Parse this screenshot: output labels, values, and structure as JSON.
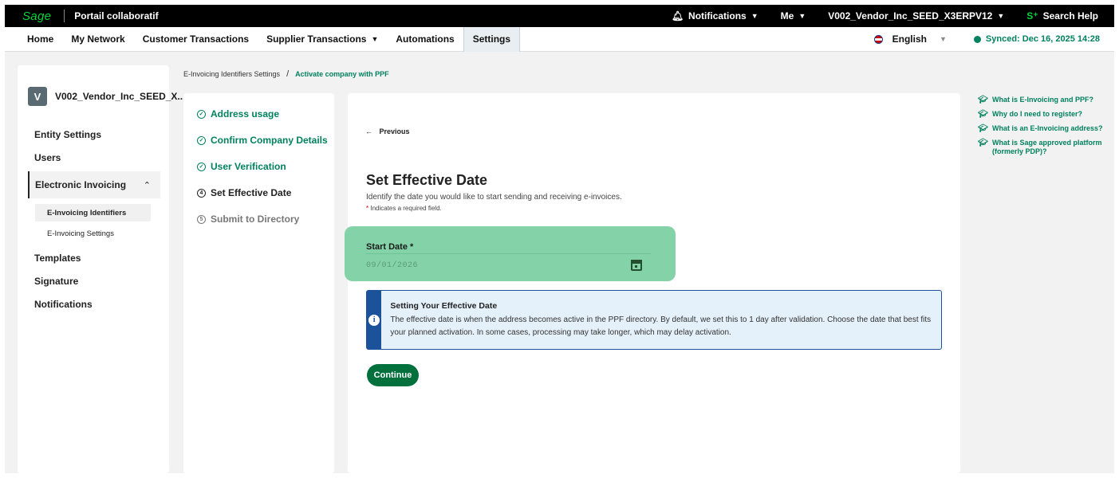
{
  "topbar": {
    "logo": "Sage",
    "app_title": "Portail collaboratif",
    "notifications": "Notifications",
    "me": "Me",
    "company": "V002_Vendor_Inc_SEED_X3ERPV12",
    "search_help": "Search Help"
  },
  "nav": {
    "items": [
      "Home",
      "My Network",
      "Customer Transactions",
      "Supplier Transactions",
      "Automations",
      "Settings"
    ],
    "language": "English",
    "synced": "Synced: Dec 16, 2025 14:28"
  },
  "sidebar": {
    "avatar": "V",
    "entity": "V002_Vendor_Inc_SEED_X...",
    "entity_settings": "Entity Settings",
    "users": "Users",
    "electronic_invoicing": "Electronic Invoicing",
    "sub_identifiers": "E-Invoicing Identifiers",
    "sub_settings": "E-Invoicing Settings",
    "templates": "Templates",
    "signature": "Signature",
    "notifications": "Notifications"
  },
  "breadcrumb": {
    "parent": "E-Invoicing Identifiers Settings",
    "separator": "/",
    "current": "Activate company with PPF"
  },
  "steps": {
    "s1": "Address usage",
    "s2": "Confirm Company Details",
    "s3": "User Verification",
    "s4_num": "4",
    "s4": "Set Effective Date",
    "s5_num": "5",
    "s5": "Submit to Directory"
  },
  "main": {
    "previous": "Previous",
    "title": "Set Effective Date",
    "description": "Identify the date you would like to start sending and receiving e-invoices.",
    "required_mark": "*",
    "required_note": " Indicates a required field.",
    "start_date_label": "Start Date *",
    "start_date_value": "09/01/2026",
    "info_title": "Setting Your Effective Date",
    "info_text": "The effective date is when the address becomes active in the PPF directory. By default, we set this to 1 day after validation. Choose the date that best fits your planned activation. In some cases, processing may take longer, which may delay activation.",
    "continue": "Continue"
  },
  "help": {
    "links": [
      "What is E-Invoicing and PPF?",
      "Why do I need to register?",
      "What is an E-Invoicing address?",
      "What is Sage approved platform (formerly PDP)?"
    ]
  }
}
